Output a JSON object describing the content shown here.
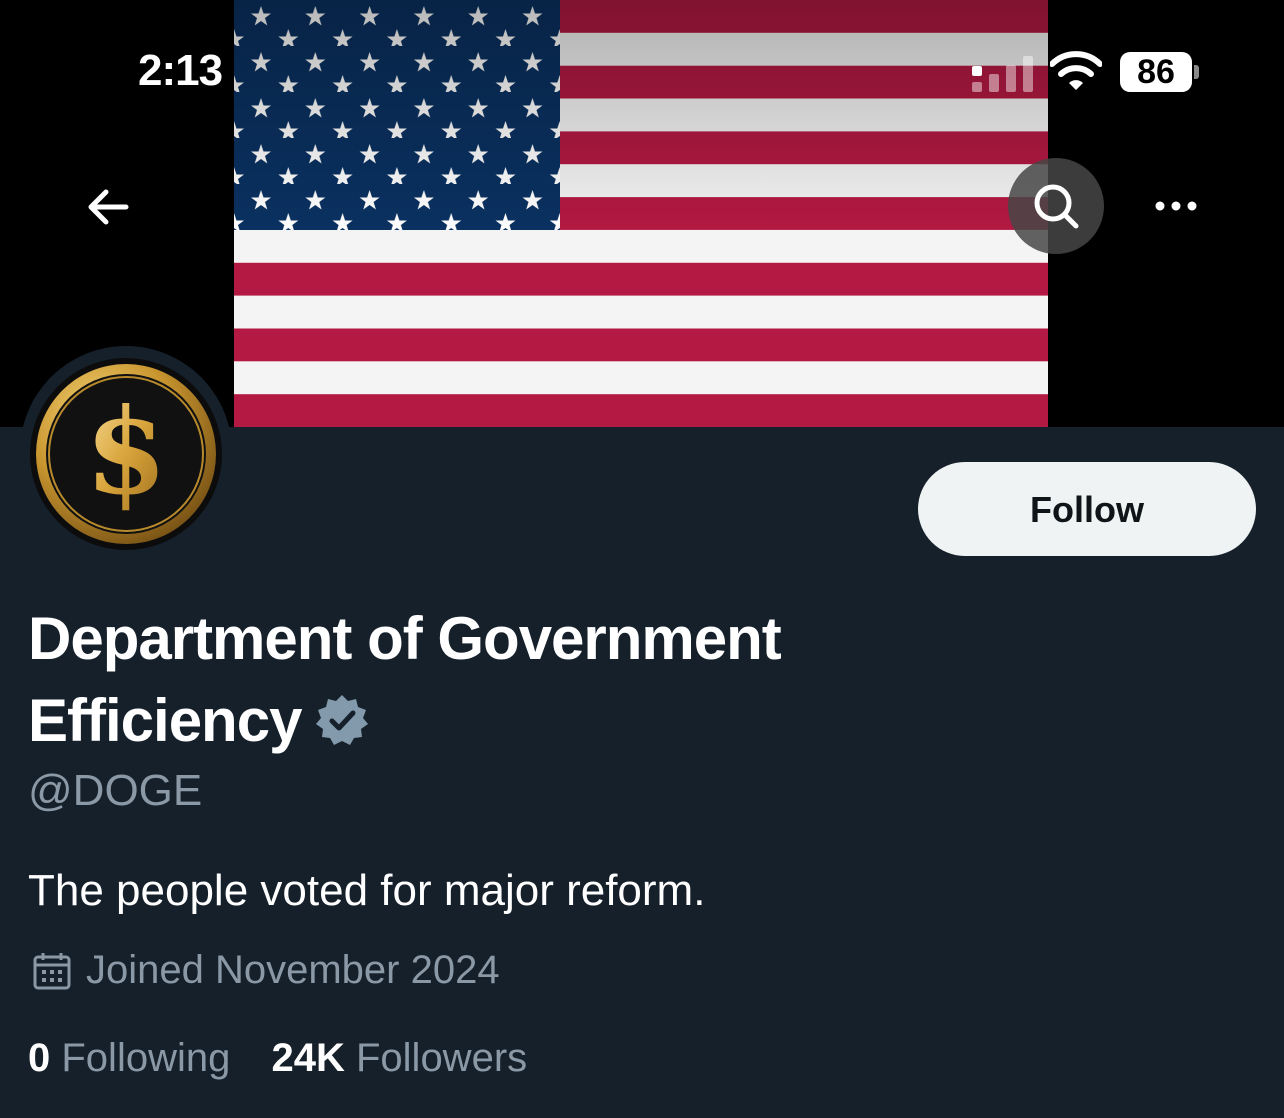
{
  "status_bar": {
    "time": "2:13",
    "battery": "86"
  },
  "header": {
    "back_icon": "arrow-left-icon",
    "search_icon": "search-icon",
    "more_icon": "more-horizontal-icon"
  },
  "profile": {
    "name": "Department of Government Efficiency",
    "handle": "@DOGE",
    "bio": "The people voted for major reform.",
    "joined": "Joined November 2024",
    "following_count": "0",
    "following_label": "Following",
    "followers_count": "24K",
    "followers_label": "Followers",
    "follow_label": "Follow"
  },
  "colors": {
    "background": "#15202b",
    "secondary_text": "#8b98a5",
    "follow_button": "#eff3f4",
    "verified_badge": "#829aab"
  }
}
